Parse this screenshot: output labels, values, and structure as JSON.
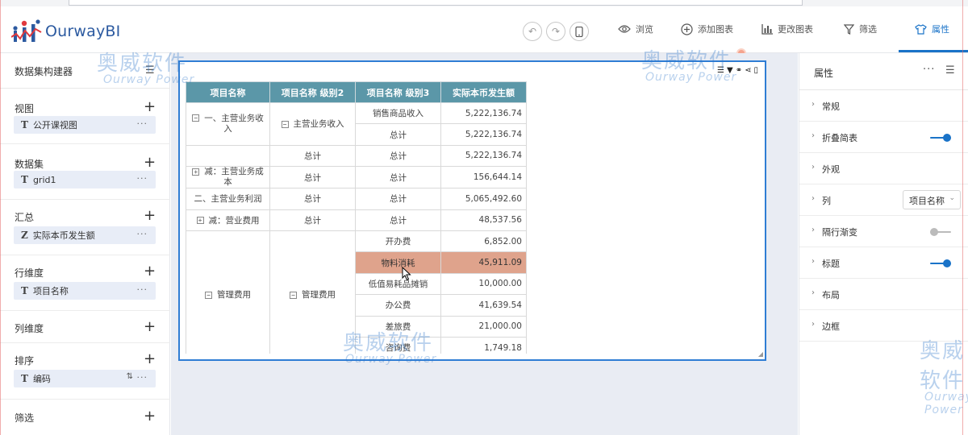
{
  "app": {
    "logo_text": "OurwayBI"
  },
  "toolbar": {
    "undo_icon": "undo-icon",
    "redo_icon": "redo-icon",
    "device_icon": "mobile-icon",
    "items": [
      {
        "label": "浏览",
        "icon": "eye-icon"
      },
      {
        "label": "添加图表",
        "icon": "plus-circle-icon"
      },
      {
        "label": "更改图表",
        "icon": "bar-chart-icon"
      },
      {
        "label": "筛选",
        "icon": "filter-icon"
      },
      {
        "label": "属性",
        "icon": "shirt-icon",
        "active": true
      }
    ]
  },
  "left_panel": {
    "title": "数据集构建器",
    "sections": [
      {
        "label": "视图",
        "chip": {
          "type": "T",
          "text": "公开课视图"
        }
      },
      {
        "label": "数据集",
        "chip": {
          "type": "T",
          "text": "grid1"
        }
      },
      {
        "label": "汇总",
        "chip": {
          "type": "Z",
          "text": "实际本币发生额"
        }
      },
      {
        "label": "行维度",
        "chip": {
          "type": "T",
          "text": "项目名称"
        }
      },
      {
        "label": "列维度",
        "chip": null
      },
      {
        "label": "排序",
        "chip": {
          "type": "T",
          "text": "编码"
        }
      },
      {
        "label": "筛选",
        "chip": null
      }
    ]
  },
  "table": {
    "headers": [
      "项目名称",
      "项目名称 级别2",
      "项目名称 级别3",
      "实际本币发生额"
    ],
    "rows": {
      "g1_l1": "一、主营业务收入",
      "g1_l2": "主营业务收入",
      "r1_l3": "销售商品收入",
      "r1_v": "5,222,136.74",
      "r2_l3": "总计",
      "r2_v": "5,222,136.74",
      "r3_l2": "总计",
      "r3_l3": "总计",
      "r3_v": "5,222,136.74",
      "r4_l1": "减：主营业务成本",
      "r4_l2": "总计",
      "r4_l3": "总计",
      "r4_v": "156,644.14",
      "r5_l1": "二、主营业务利润",
      "r5_l2": "总计",
      "r5_l3": "总计",
      "r5_v": "5,065,492.60",
      "r6_l1": "减：营业费用",
      "r6_l2": "总计",
      "r6_l3": "总计",
      "r6_v": "48,537.56",
      "g7_l1": "管理费用",
      "g7_l2": "管理费用",
      "r7_l3": "开办费",
      "r7_v": "6,852.00",
      "r8_l3": "物料消耗",
      "r8_v": "45,911.09",
      "r9_l3": "低值易耗品摊销",
      "r9_v": "10,000.00",
      "r10_l3": "办公费",
      "r10_v": "41,639.54",
      "r11_l3": "差旅费",
      "r11_v": "21,000.00",
      "r12_l3": "咨询费",
      "r12_v": "1,749.18"
    },
    "highlight_color": "#dfa38c",
    "header_color": "#5b97a8"
  },
  "right_panel": {
    "title": "属性",
    "props": [
      {
        "label": "常规",
        "control": "none"
      },
      {
        "label": "折叠简表",
        "control": "switch",
        "on": true
      },
      {
        "label": "外观",
        "control": "none"
      },
      {
        "label": "列",
        "control": "select",
        "value": "项目名称"
      },
      {
        "label": "隔行渐变",
        "control": "switch",
        "on": false
      },
      {
        "label": "标题",
        "control": "switch",
        "on": true
      },
      {
        "label": "布局",
        "control": "none"
      },
      {
        "label": "边框",
        "control": "none"
      }
    ]
  },
  "watermark": {
    "cn": "奥威软件",
    "en": "Ourway Power"
  },
  "colors": {
    "accent": "#1a73c8",
    "brand": "#2c5aa0",
    "switch_on": "#1a73c8",
    "switch_off": "#bbbbbb"
  }
}
